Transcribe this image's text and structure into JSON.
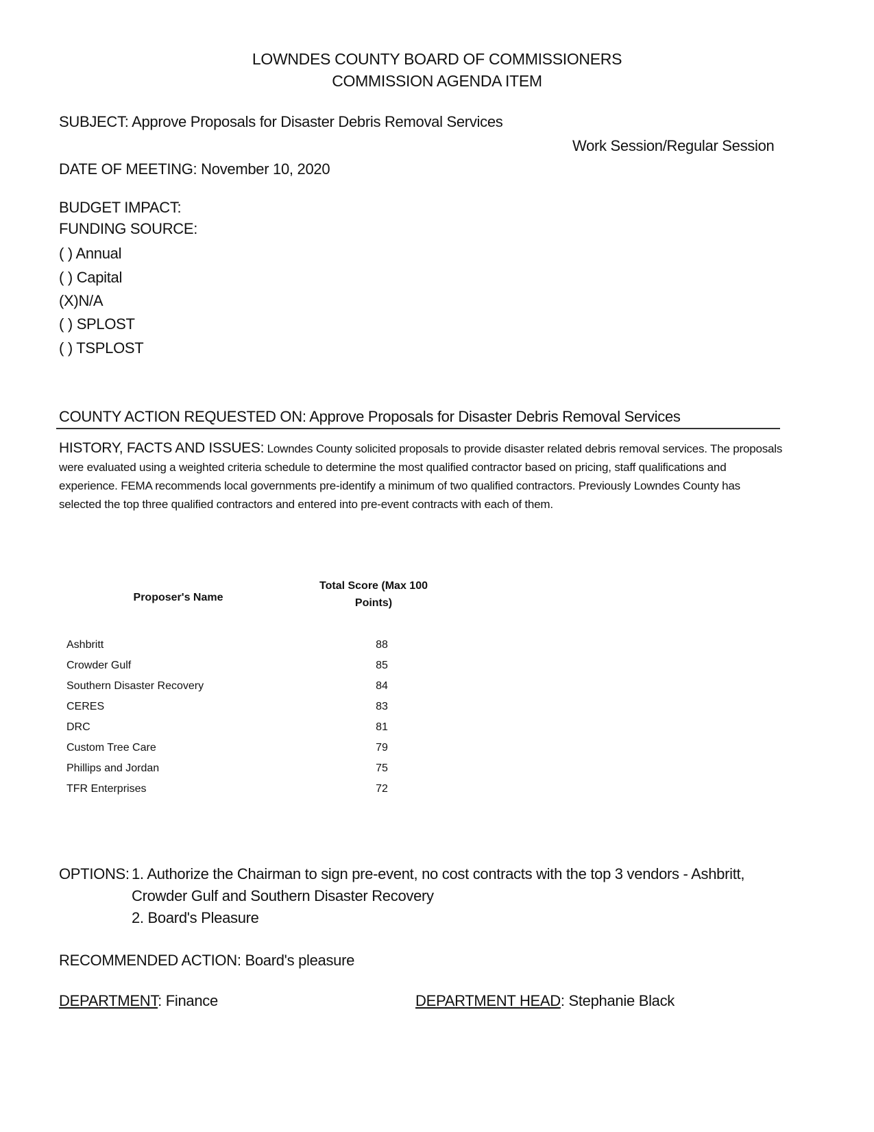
{
  "header": {
    "line1": "LOWNDES COUNTY BOARD OF COMMISSIONERS",
    "line2": "COMMISSION AGENDA ITEM"
  },
  "subject": "SUBJECT: Approve Proposals for Disaster Debris Removal Services",
  "session": "Work Session/Regular Session",
  "date_of_meeting": "DATE OF MEETING: November 10, 2020",
  "budget_impact": "BUDGET IMPACT:",
  "funding_source": {
    "label": "FUNDING SOURCE:",
    "options": [
      {
        "mark": "( )",
        "label": "Annual",
        "checked": false
      },
      {
        "mark": "( )",
        "label": "Capital",
        "checked": false
      },
      {
        "mark": "(X)",
        "label": "N/A",
        "checked": true
      },
      {
        "mark": "( )",
        "label": "SPLOST",
        "checked": false
      },
      {
        "mark": "( )",
        "label": "TSPLOST",
        "checked": false
      }
    ]
  },
  "county_action": "COUNTY ACTION REQUESTED ON: Approve Proposals for Disaster Debris Removal Services",
  "history": {
    "label": "HISTORY, FACTS AND ISSUES:",
    "text": " Lowndes County solicited proposals to provide disaster related debris removal services.  The proposals were evaluated using a weighted criteria schedule to determine the most qualified contractor based on pricing, staff qualifications and experience.  FEMA recommends local governments pre-identify a minimum of two qualified contractors. Previously Lowndes County has selected the top three qualified contractors and entered into pre-event contracts with each of them."
  },
  "table": {
    "headers": [
      "Proposer's Name",
      "Total Score (Max 100 Points)"
    ],
    "header2_line1": "Total Score (Max 100",
    "header2_line2": "Points)",
    "rows": [
      {
        "name": "Ashbritt",
        "score": "88"
      },
      {
        "name": "Crowder Gulf",
        "score": "85"
      },
      {
        "name": "Southern Disaster Recovery",
        "score": "84"
      },
      {
        "name": "CERES",
        "score": "83"
      },
      {
        "name": "DRC",
        "score": "81"
      },
      {
        "name": "Custom Tree Care",
        "score": "79"
      },
      {
        "name": "Phillips and Jordan",
        "score": "75"
      },
      {
        "name": "TFR Enterprises",
        "score": "72"
      }
    ]
  },
  "options": {
    "label": "OPTIONS:",
    "item1_line1": "1. Authorize the Chairman to sign pre-event, no cost contracts with the top 3 vendors - Ashbritt,",
    "item1_line2": "Crowder Gulf and Southern Disaster Recovery",
    "item2": "2. Board's Pleasure"
  },
  "recommended_action": "RECOMMENDED ACTION: Board's pleasure",
  "department": {
    "label": "DEPARTMENT",
    "value": ": Finance"
  },
  "department_head": {
    "label": "DEPARTMENT HEAD",
    "value": ": Stephanie Black"
  }
}
